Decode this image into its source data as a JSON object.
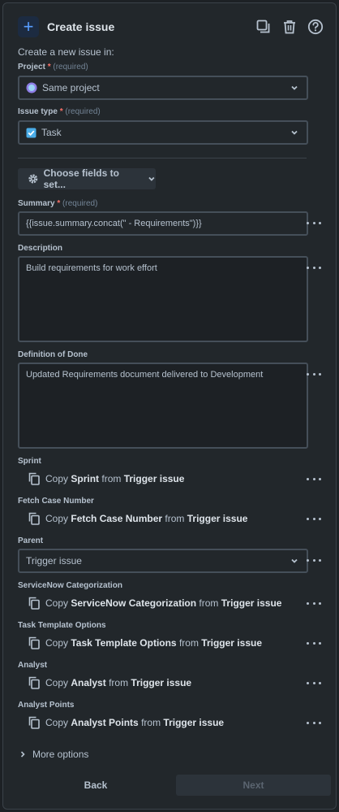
{
  "header": {
    "title": "Create issue",
    "plus_icon": "+",
    "actions": [
      "duplicate-icon",
      "trash-icon",
      "help-icon"
    ]
  },
  "subtitle": "Create a new issue in:",
  "project": {
    "label": "Project",
    "required_mark": "*",
    "required_text": "(required)",
    "value": "Same project"
  },
  "issue_type": {
    "label": "Issue type",
    "required_mark": "*",
    "required_text": "(required)",
    "value": "Task"
  },
  "choose_fields": {
    "label": "Choose fields to set..."
  },
  "summary": {
    "label": "Summary",
    "required_mark": "*",
    "required_text": "(required)",
    "value": "{{issue.summary.concat(\" - Requirements\")}}"
  },
  "description": {
    "label": "Description",
    "value": "Build requirements for work effort"
  },
  "definition_of_done": {
    "label": "Definition of Done",
    "value": "Updated Requirements document delivered to Development"
  },
  "copy_fields": [
    {
      "label": "Sprint",
      "prefix": "Copy",
      "field": "Sprint",
      "mid": "from",
      "source": "Trigger issue"
    },
    {
      "label": "Fetch Case Number",
      "prefix": "Copy",
      "field": "Fetch Case Number",
      "mid": "from",
      "source": "Trigger issue"
    }
  ],
  "parent": {
    "label": "Parent",
    "value": "Trigger issue"
  },
  "copy_fields_2": [
    {
      "label": "ServiceNow Categorization",
      "prefix": "Copy",
      "field": "ServiceNow Categorization",
      "mid": "from",
      "source": "Trigger issue"
    },
    {
      "label": "Task Template Options",
      "prefix": "Copy",
      "field": "Task Template Options",
      "mid": "from",
      "source": "Trigger issue"
    },
    {
      "label": "Analyst",
      "prefix": "Copy",
      "field": "Analyst",
      "mid": "from",
      "source": "Trigger issue"
    },
    {
      "label": "Analyst Points",
      "prefix": "Copy",
      "field": "Analyst Points",
      "mid": "from",
      "source": "Trigger issue"
    }
  ],
  "more_options": "More options",
  "footer": {
    "back": "Back",
    "next": "Next"
  },
  "colors": {
    "background": "#22272b",
    "accent": "#579dff",
    "border": "#454f59",
    "required": "#f87168"
  }
}
